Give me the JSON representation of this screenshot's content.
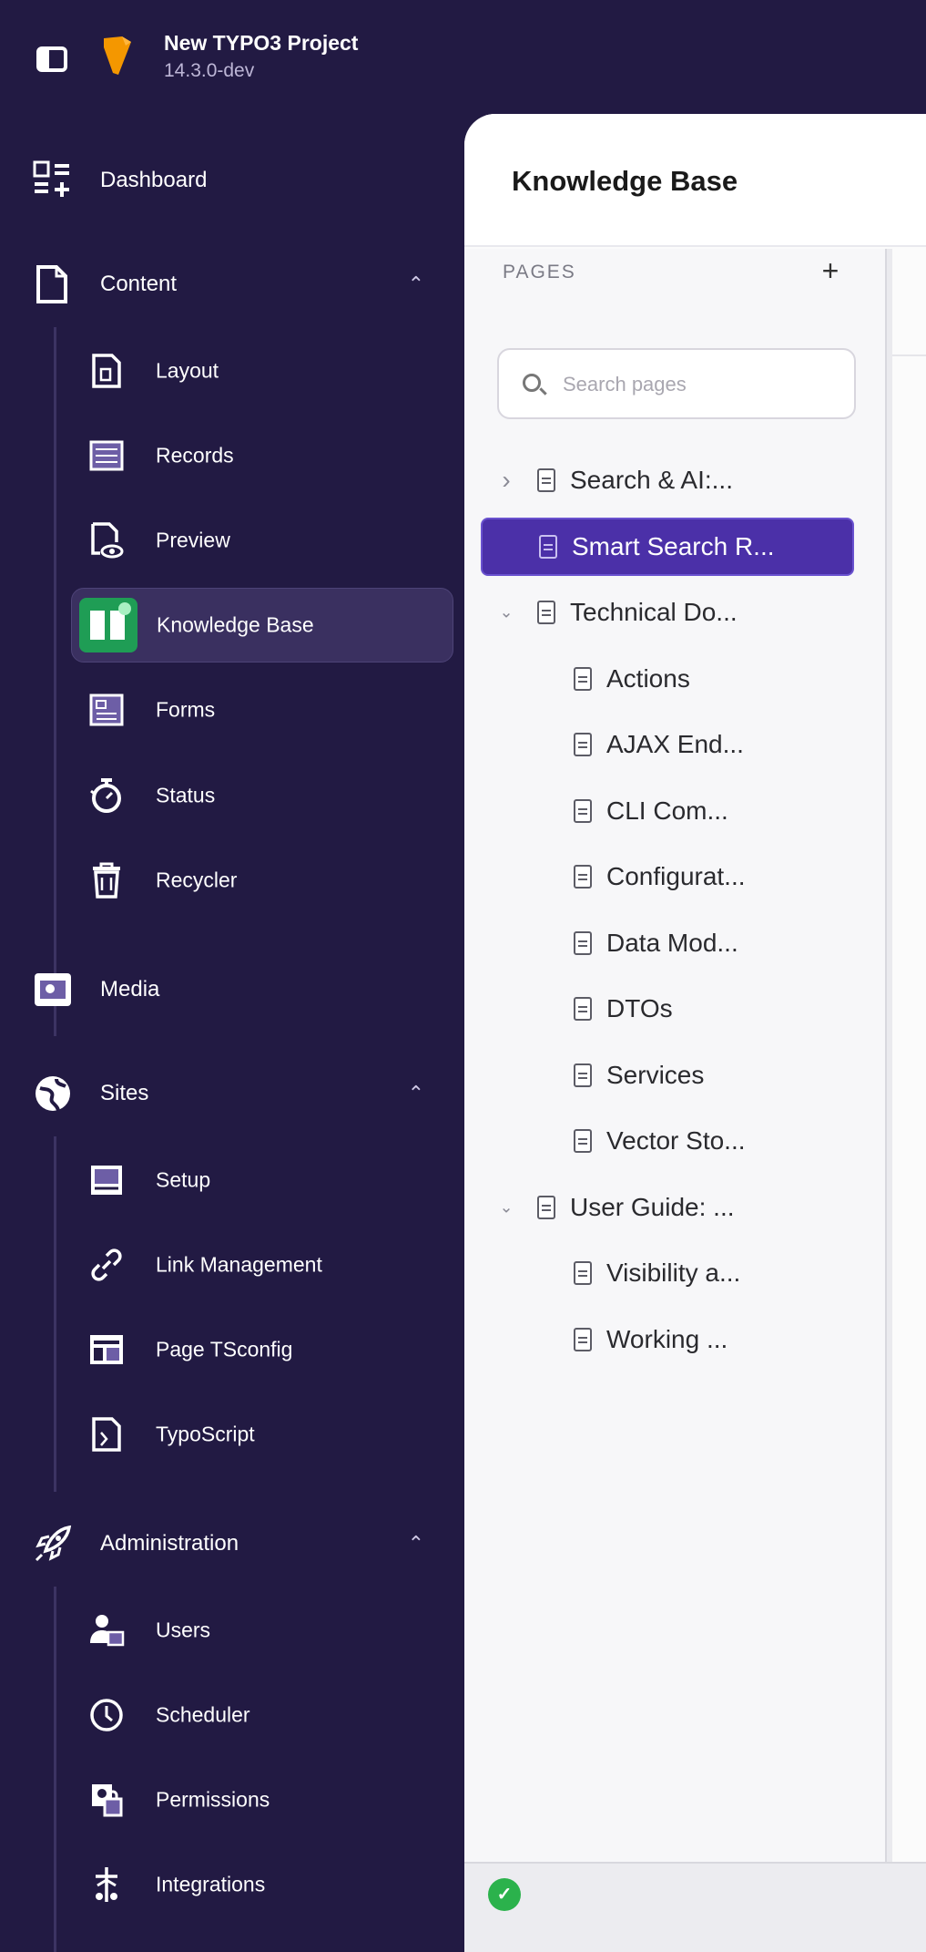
{
  "app": {
    "project_name": "New TYPO3 Project",
    "version": "14.3.0-dev"
  },
  "sidebar": {
    "items": [
      {
        "label": "Dashboard"
      },
      {
        "label": "Content",
        "children": [
          "Layout",
          "Records",
          "Preview",
          "Knowledge Base",
          "Forms",
          "Status",
          "Recycler"
        ]
      },
      {
        "label": "Media"
      },
      {
        "label": "Sites",
        "children": [
          "Setup",
          "Link Management",
          "Page TSconfig",
          "TypoScript"
        ]
      },
      {
        "label": "Administration",
        "children": [
          "Users",
          "Scheduler",
          "Permissions",
          "Integrations"
        ]
      }
    ],
    "active": "Knowledge Base"
  },
  "main": {
    "title": "Knowledge Base",
    "pages_caption": "PAGES",
    "search_placeholder": "Search pages",
    "tree": [
      {
        "label": "Search & AI:...",
        "level": 0,
        "toggle": "collapsed"
      },
      {
        "label": "Smart Search R...",
        "level": 0,
        "selected": true
      },
      {
        "label": "Technical Do...",
        "level": 0,
        "toggle": "expanded"
      },
      {
        "label": "Actions",
        "level": 1
      },
      {
        "label": "AJAX End...",
        "level": 1
      },
      {
        "label": "CLI Com...",
        "level": 1
      },
      {
        "label": "Configurat...",
        "level": 1
      },
      {
        "label": "Data Mod...",
        "level": 1
      },
      {
        "label": "DTOs",
        "level": 1
      },
      {
        "label": "Services",
        "level": 1
      },
      {
        "label": "Vector Sto...",
        "level": 1
      },
      {
        "label": "User Guide: ...",
        "level": 0,
        "toggle": "expanded"
      },
      {
        "label": "Visibility a...",
        "level": 1
      },
      {
        "label": "Working ...",
        "level": 1
      }
    ]
  },
  "colors": {
    "sidebar_bg": "#221a43",
    "accent": "#4b30a8",
    "brand_orange": "#f49700",
    "kb_green": "#1f9d55"
  }
}
